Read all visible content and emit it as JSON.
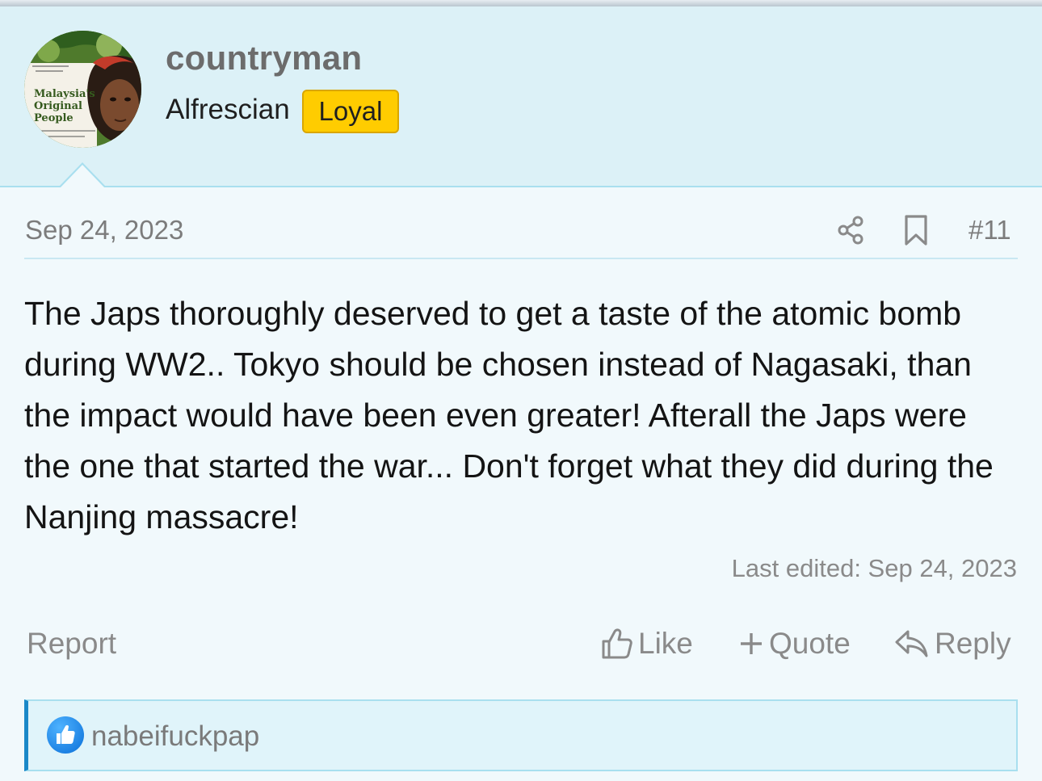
{
  "user": {
    "name": "countryman",
    "title": "Alfrescian",
    "badge": "Loyal",
    "avatar_text": [
      "Malaysia's",
      "Original",
      "People"
    ]
  },
  "post": {
    "date": "Sep 24, 2023",
    "number": "#11",
    "body": "The Japs thoroughly deserved to get a taste of the atomic bomb during WW2.. Tokyo should be chosen instead of Nagasaki, than the impact would have been even greater! Afterall the Japs were the one that started the war... Don't forget what they did during the Nanjing massacre!",
    "last_edited": "Last edited: Sep 24, 2023"
  },
  "actions": {
    "report": "Report",
    "like": "Like",
    "quote": "Quote",
    "reply": "Reply"
  },
  "reactions": {
    "users": "nabeifuckpap"
  },
  "colors": {
    "badge": "#ffcc00",
    "accent": "#1a88c8",
    "userbar_bg": "#dcf1f7"
  },
  "icons": {
    "share": "share-icon",
    "bookmark": "bookmark-icon",
    "like": "thumbs-up-icon",
    "quote": "plus-icon",
    "reply": "reply-arrow-icon",
    "reaction": "like-reaction-icon"
  }
}
